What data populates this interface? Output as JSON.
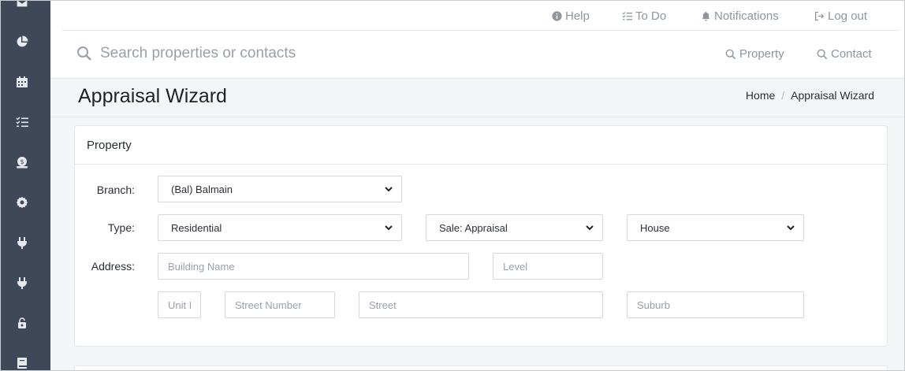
{
  "topnav": {
    "help": "Help",
    "todo": "To Do",
    "notifications": "Notifications",
    "logout": "Log out"
  },
  "search": {
    "placeholder": "Search properties or contacts",
    "property_label": "Property",
    "contact_label": "Contact"
  },
  "page": {
    "title": "Appraisal Wizard"
  },
  "breadcrumb": {
    "home": "Home",
    "current": "Appraisal Wizard"
  },
  "sidebar": {
    "icons": [
      "mail-icon",
      "pie-chart-icon",
      "calendar-icon",
      "checklist-icon",
      "money-icon",
      "gear-icon",
      "plug-icon",
      "plug-icon",
      "lock-icon",
      "book-icon"
    ]
  },
  "property_card": {
    "title": "Property",
    "branch_label": "Branch:",
    "branch_value": "(Bal) Balmain",
    "type_label": "Type:",
    "type_value": "Residential",
    "sale_value": "Sale: Appraisal",
    "category_value": "House",
    "address_label": "Address:",
    "building_placeholder": "Building Name",
    "level_placeholder": "Level",
    "unit_placeholder": "Unit I",
    "street_number_placeholder": "Street Number",
    "street_placeholder": "Street",
    "suburb_placeholder": "Suburb"
  },
  "colors": {
    "sidebar": "#3e4859",
    "muted_text": "#8e959e",
    "border": "#d4d8dd"
  }
}
